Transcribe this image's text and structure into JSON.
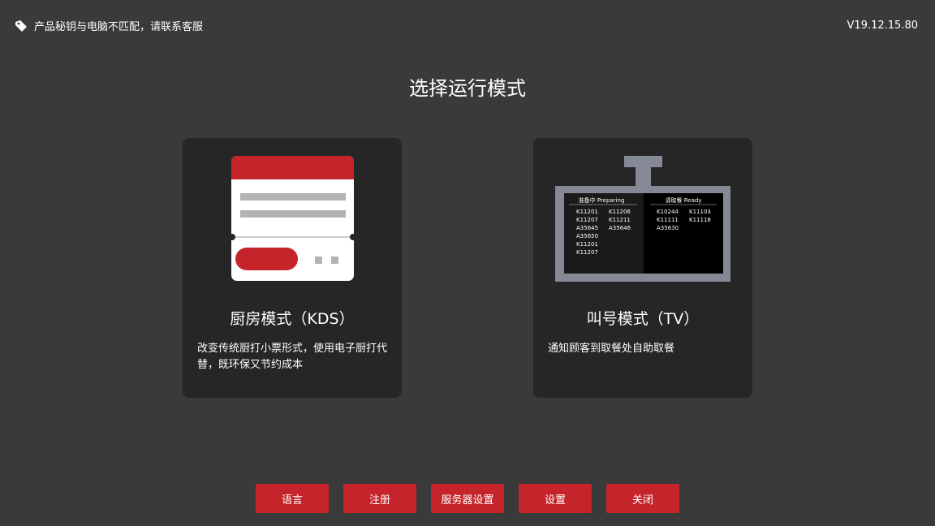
{
  "colors": {
    "background": "#3a3a3a",
    "card": "#262626",
    "accent": "#c4242a"
  },
  "header": {
    "notice_icon": "tag-icon",
    "notice_text": "产品秘钥与电脑不匹配，请联系客服",
    "version": "V19.12.15.80"
  },
  "page_title": "选择运行模式",
  "modes": {
    "kds": {
      "icon": "receipt-printer-icon",
      "title": "厨房模式（KDS）",
      "description": "改变传统厨打小票形式，使用电子厨打代替，既环保又节约成本"
    },
    "tv": {
      "icon": "tv-board-icon",
      "title": "叫号模式（TV）",
      "description": "通知顾客到取餐处自助取餐",
      "board": {
        "preparing_header": "准备中 Preparing",
        "ready_header": "请取餐 Ready",
        "preparing_col1": [
          "K11201",
          "K11207",
          "A35645",
          "A35650",
          "K11201",
          "K11207"
        ],
        "preparing_col2": [
          "K11206",
          "K11211",
          "A35646"
        ],
        "ready_col1": [
          "K10244",
          "K11111",
          "A35630"
        ],
        "ready_col2": [
          "K11103",
          "K11118"
        ]
      }
    }
  },
  "buttons": {
    "language": "语言",
    "register": "注册",
    "server_settings": "服务器设置",
    "settings": "设置",
    "close": "关闭"
  }
}
